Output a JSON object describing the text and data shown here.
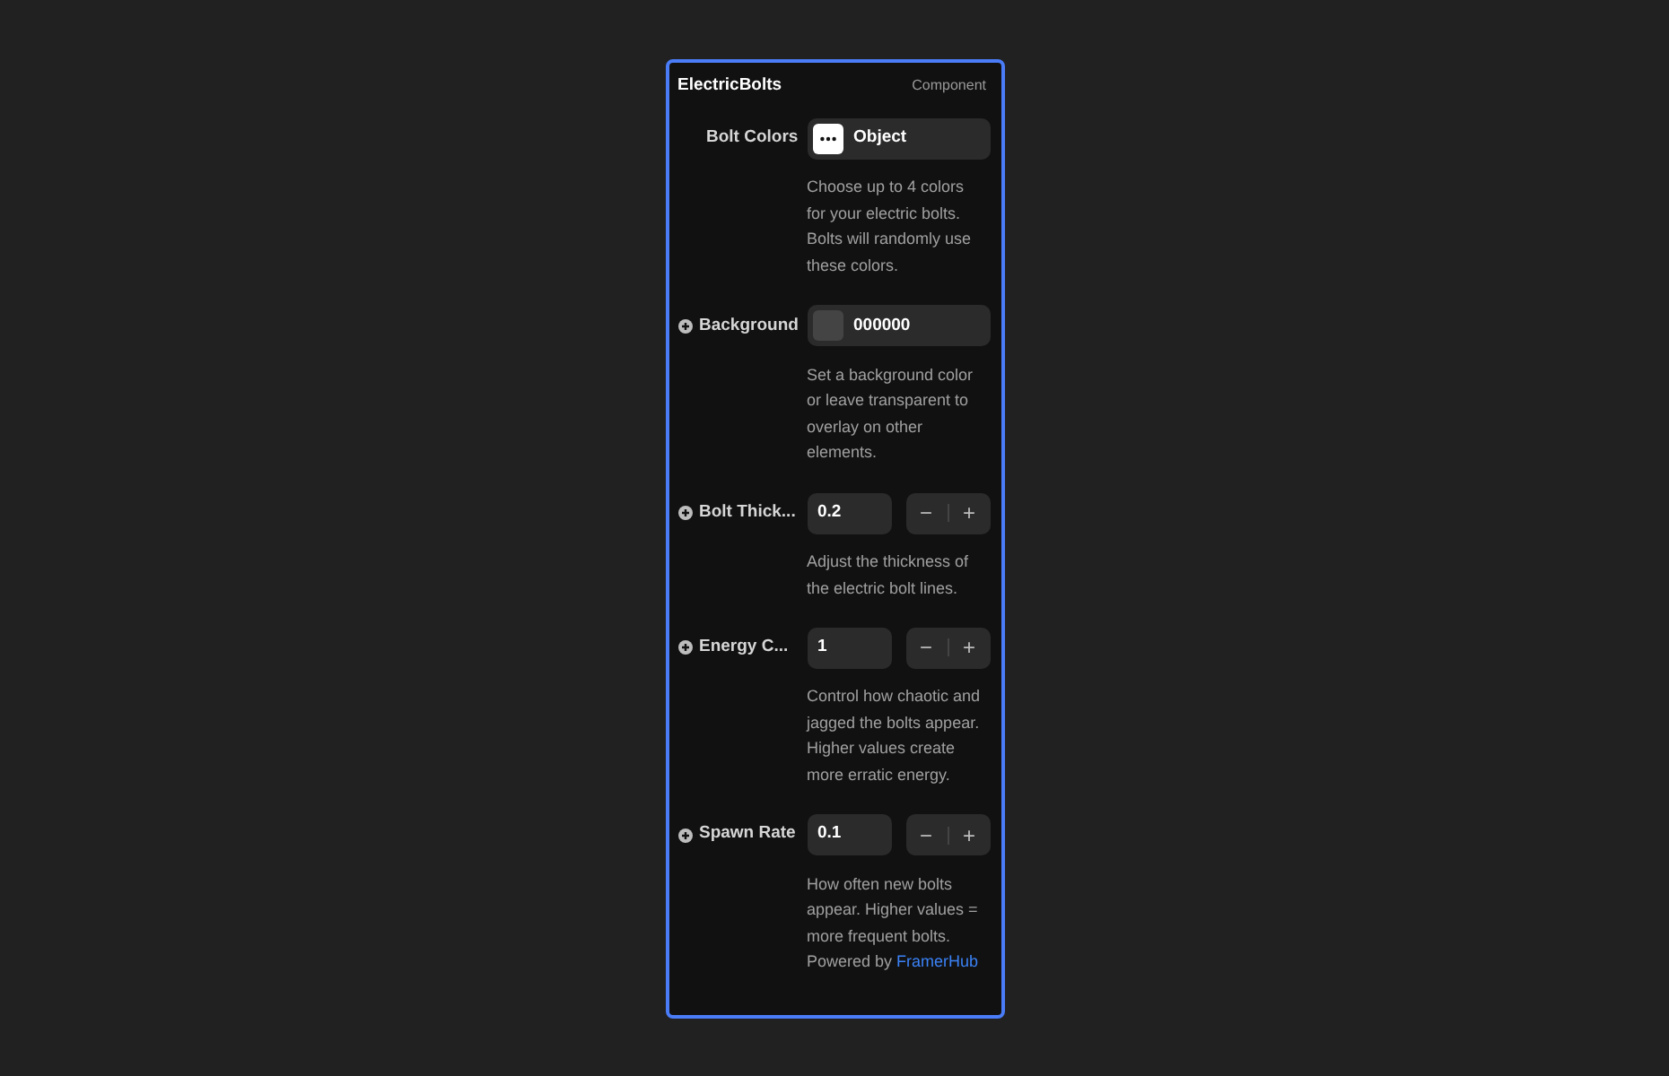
{
  "panel": {
    "title": "ElectricBolts",
    "badge": "Component"
  },
  "rows": [
    {
      "kind": "object",
      "label": "Bolt Colors",
      "removable": false,
      "value": "Object",
      "description": "Choose up to 4 colors for your electric bolts. Bolts will randomly use these colors."
    },
    {
      "kind": "color",
      "label": "Background",
      "removable": true,
      "value": "000000",
      "description": "Set a background color or leave transparent to overlay on other elements."
    },
    {
      "kind": "number",
      "label": "Bolt Thick...",
      "removable": true,
      "value": "0.2",
      "minus": "−",
      "plus": "+",
      "description": "Adjust the thickness of the electric bolt lines."
    },
    {
      "kind": "number",
      "label": "Energy C...",
      "removable": true,
      "value": "1",
      "minus": "−",
      "plus": "+",
      "description": "Control how chaotic and jagged the bolts appear. Higher values create more erratic energy."
    },
    {
      "kind": "number",
      "label": "Spawn Rate",
      "removable": true,
      "value": "0.1",
      "minus": "−",
      "plus": "+",
      "description": "How often new bolts appear. Higher values = more frequent bolts.",
      "credit": {
        "text": "Powered by",
        "link": "FramerHub"
      }
    }
  ]
}
